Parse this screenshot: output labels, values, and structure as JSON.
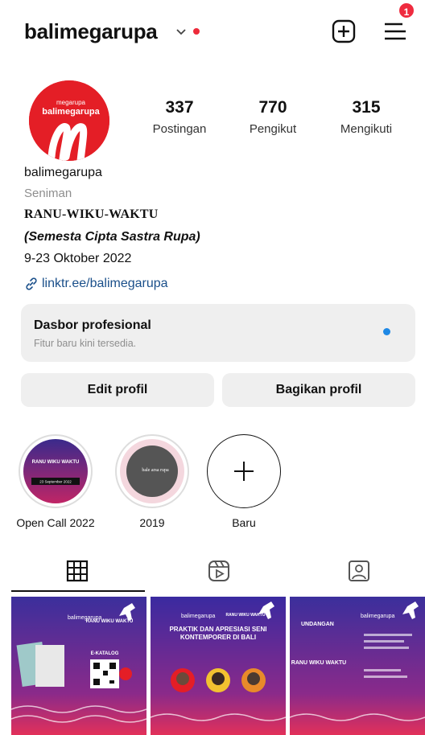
{
  "header": {
    "username": "balimegarupa",
    "notification_count": "1",
    "icons": [
      "chevron-down-icon",
      "new-post-icon",
      "menu-icon"
    ]
  },
  "profile": {
    "avatar_text": "balimegarupa",
    "avatar_text_small": "megarupa",
    "stats": [
      {
        "value": "337",
        "label": "Postingan"
      },
      {
        "value": "770",
        "label": "Pengikut"
      },
      {
        "value": "315",
        "label": "Mengikuti"
      }
    ],
    "name": "balimegarupa",
    "category": "Seniman",
    "bio_line1": "RANU-WIKU-WAKTU",
    "bio_line2": "(Semesta Cipta Sastra Rupa)",
    "bio_line3": "9-23 Oktober 2022",
    "link": "linktr.ee/balimegarupa"
  },
  "dashboard": {
    "title": "Dasbor profesional",
    "subtitle": "Fitur baru kini tersedia."
  },
  "buttons": {
    "edit": "Edit profil",
    "share": "Bagikan profil"
  },
  "highlights": [
    {
      "label": "Open Call 2022",
      "thumb_text": "RANU WIKU WAKTU",
      "thumb_date": "23 September 2022"
    },
    {
      "label": "2019",
      "thumb_text": "bale arsa rupa"
    },
    {
      "label": "Baru"
    }
  ],
  "tabs": [
    "grid-icon",
    "reels-icon",
    "tagged-icon"
  ],
  "posts": [
    {
      "logo": "balimegarupa",
      "title": "RANU WIKU WAKTU",
      "caption": "E-KATALOG"
    },
    {
      "logo": "balimegarupa",
      "title": "PRAKTIK DAN APRESIASI SENI KONTEMPORER DI BALI",
      "tag": "RANU WIKU WAKTU"
    },
    {
      "logo": "balimegarupa",
      "title": "UNDANGAN",
      "subtitle": "RANU WIKU WAKTU"
    }
  ],
  "colors": {
    "accent_red": "#e41e26",
    "badge_red": "#ef2b3f",
    "link_blue": "#1a4f8a",
    "dot_blue": "#1e88e5",
    "button_gray": "#efefef"
  }
}
